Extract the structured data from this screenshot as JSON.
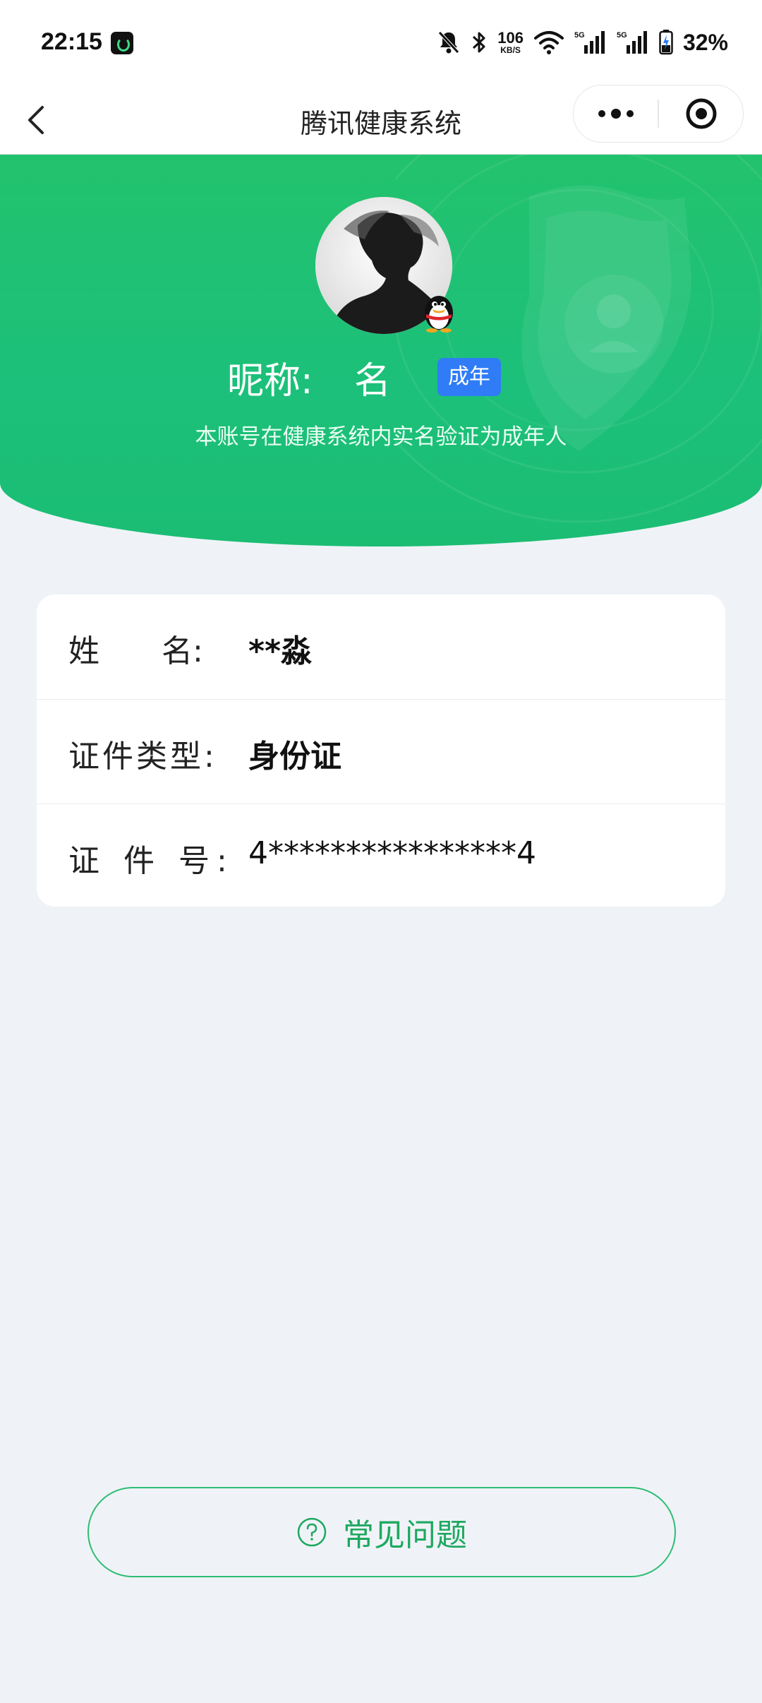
{
  "status_bar": {
    "time": "22:15",
    "net_speed_value": "106",
    "net_speed_unit": "KB/S",
    "network_1": "5G",
    "network_2": "5G",
    "battery_percent": "32%"
  },
  "nav": {
    "title": "腾讯健康系统"
  },
  "header": {
    "nickname_label": "昵称:",
    "nickname_value": "名",
    "adult_badge": "成年",
    "verify_text": "本账号在健康系统内实名验证为成年人"
  },
  "info": {
    "rows": [
      {
        "label": "姓　　名:",
        "value": "**淼"
      },
      {
        "label": "证件类型:",
        "value": "身份证"
      },
      {
        "label": "证 件 号:",
        "value": "4****************4"
      }
    ]
  },
  "faq": {
    "label": "常见问题"
  },
  "colors": {
    "brand_green": "#22c26d",
    "adult_badge_blue": "#2f7cf6",
    "page_background": "#eff3f7"
  }
}
